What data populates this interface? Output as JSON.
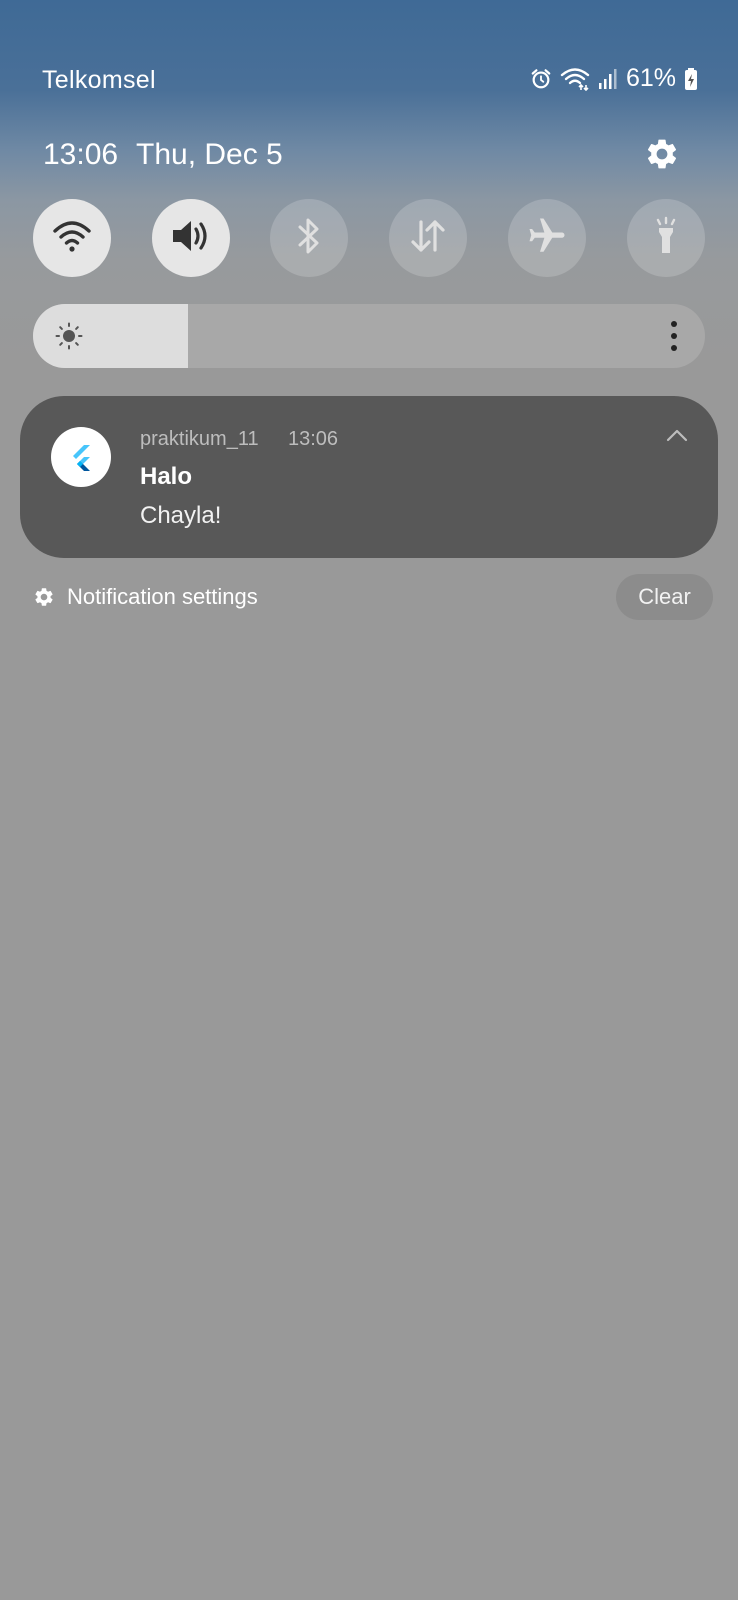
{
  "status_bar": {
    "carrier": "Telkomsel",
    "battery": "61%",
    "icons": [
      "alarm-icon",
      "wifi-icon",
      "signal-icon",
      "battery-icon"
    ]
  },
  "header": {
    "time": "13:06",
    "date": "Thu, Dec 5",
    "settings_icon": "gear-icon"
  },
  "quick_toggles": [
    {
      "name": "wifi",
      "icon": "wifi-icon",
      "on": true
    },
    {
      "name": "sound",
      "icon": "volume-icon",
      "on": true
    },
    {
      "name": "bluetooth",
      "icon": "bluetooth-icon",
      "on": false
    },
    {
      "name": "mobile-data",
      "icon": "data-transfer-icon",
      "on": false
    },
    {
      "name": "airplane-mode",
      "icon": "airplane-icon",
      "on": false
    },
    {
      "name": "flashlight",
      "icon": "flashlight-icon",
      "on": false
    }
  ],
  "brightness": {
    "level": 0.23,
    "icon": "sun-icon",
    "more_icon": "more-vertical-icon"
  },
  "notification": {
    "app_name": "praktikum_11",
    "time": "13:06",
    "title": "Halo",
    "body": "Chayla!",
    "app_icon": "flutter-icon",
    "collapse_icon": "chevron-up-icon"
  },
  "footer": {
    "settings_label": "Notification settings",
    "clear_label": "Clear"
  },
  "colors": {
    "toggle_on": "#e6e6e6",
    "toggle_off_icon": "#e0e0e0",
    "toggle_on_icon": "#333333",
    "notification_bg": "#585858",
    "page_bg": "#999999"
  }
}
